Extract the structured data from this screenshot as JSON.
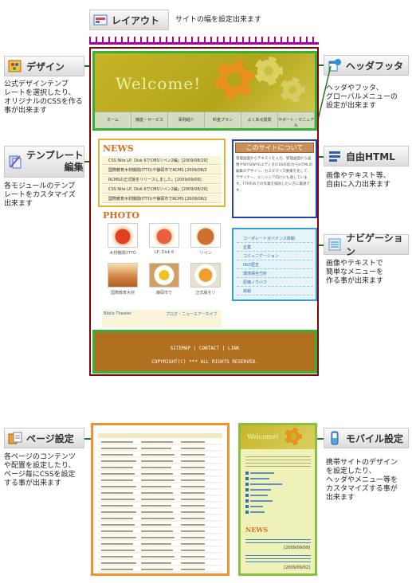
{
  "layout": {
    "label": "レイアウト",
    "desc": "サイトの幅を設定出来ます"
  },
  "design": {
    "label": "デザイン",
    "desc": [
      "公式デザインテンプ",
      "レートを選択したり、",
      "オリジナルのCSSを作る",
      "事が出来ます"
    ]
  },
  "template": {
    "label1": "テンプレート",
    "label2": "編集",
    "desc": [
      "各モジュールのテンプ",
      "レートをカスタマイズ",
      "出来ます"
    ]
  },
  "header_footer": {
    "label": "ヘッダフッタ",
    "desc": [
      "ヘッダやフッタ、",
      "グローバルメニューの",
      "設定が出来ます"
    ]
  },
  "free_html": {
    "label": "自由HTML",
    "desc": [
      "画像やテキスト等、",
      "自由に入力出来ます"
    ]
  },
  "navigation": {
    "label": "ナビゲーション",
    "desc": [
      "画像やテキストで",
      "簡単なメニューを",
      "作る事が出来ます"
    ]
  },
  "page_settings": {
    "label": "ページ設定",
    "desc": [
      "各ページのコンテンツ",
      "や配置を設定したり、",
      "ページ毎にCSSを設定",
      "する事が出来ます"
    ]
  },
  "mobile": {
    "label": "モバイル設定",
    "desc": [
      "携帯サイトのデザイン",
      "を設定したり、",
      "ヘッダやメニュー等を",
      "カスタマイズする事が",
      "出来ます"
    ]
  },
  "mock": {
    "welcome": "Welcome!",
    "nav": [
      "ホーム",
      "機能・サービス",
      "事例紹介",
      "料金プラン",
      "よくある質問",
      "サポート・マニュアル"
    ],
    "news_title": "NEWS",
    "news": [
      "CSS Nite LP, Disk 6でCMSリペン2編」[2009/08/29]",
      "国際教育木材機関(ITTO)や静岡市でRCMS [2009/08/2",
      "RCMSの正式版をリリースしました。[2009/09/09]",
      "CSS Nite LP, Disk 6でCMSリペン2編」[2009/08/29]",
      "国際教育木材機関(ITTO)や静岡市でRCMS [2009/08/2"
    ],
    "photo_title": "PHOTO",
    "photos": [
      "木材機関(ITTO",
      "LP, Disk 6",
      "リペン",
      "国際教育木材",
      "静岡市で",
      "正式版をリ"
    ],
    "bottom_left": "Biblio Theater",
    "bottom_right": "ブログ・ニュースアーカイブ",
    "html_title": "このサイトについて",
    "html_text": "管理画面からテキストを入力、管理画面から画像やWYSIWYGエディタ(CSSの枠)からHTMLの編集のデザイン、カスタマイズ要素を化して、デザイナー、エンジニア向けにも適しています。FTPのみでの作業を排除したい方に最適です。",
    "navi": [
      "コーポレートガバナンス体制",
      "企業",
      "コミュニケーション",
      "IRの歴史",
      "環境保全方針",
      "原価ノウハウ",
      "目録"
    ],
    "footer_links": "SITEMAP | CONTACT | LINK",
    "footer_copy": "COPYRIGHT(C) *** ALL RIGHTS RESERVED."
  },
  "mobile_mock": {
    "welcome": "Welcome!",
    "news": "NEWS",
    "date1": "[2009/09/09]",
    "date2": "[2009/09/02]"
  },
  "colors": {
    "accent_red": "#8a0000",
    "accent_green": "#38b038",
    "accent_orange": "#e8b030",
    "accent_blue": "#2040b0"
  }
}
